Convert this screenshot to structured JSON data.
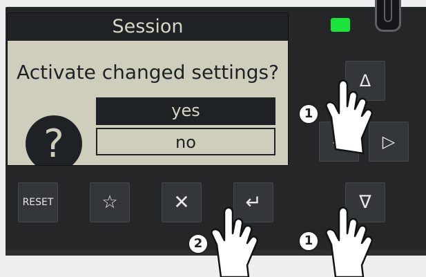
{
  "screen": {
    "title": "Session",
    "question": "Activate changed settings?",
    "help_symbol": "?",
    "options": [
      {
        "label": "yes",
        "selected": false
      },
      {
        "label": "no",
        "selected": true
      }
    ]
  },
  "status": {
    "led_color": "#1be43c"
  },
  "nav_keys": {
    "up": "Δ",
    "left": "◁",
    "right": "▷",
    "down": "∇"
  },
  "function_keys": {
    "reset": "RESET",
    "favorite": "☆",
    "cancel": "✕",
    "enter": "↵"
  },
  "steps": {
    "nav": "1",
    "enter": "2"
  },
  "colors": {
    "screen_bg": "#cfcdbb",
    "screen_dark": "#1f2224",
    "panel": "#242628",
    "key_bg": "#34373a"
  }
}
